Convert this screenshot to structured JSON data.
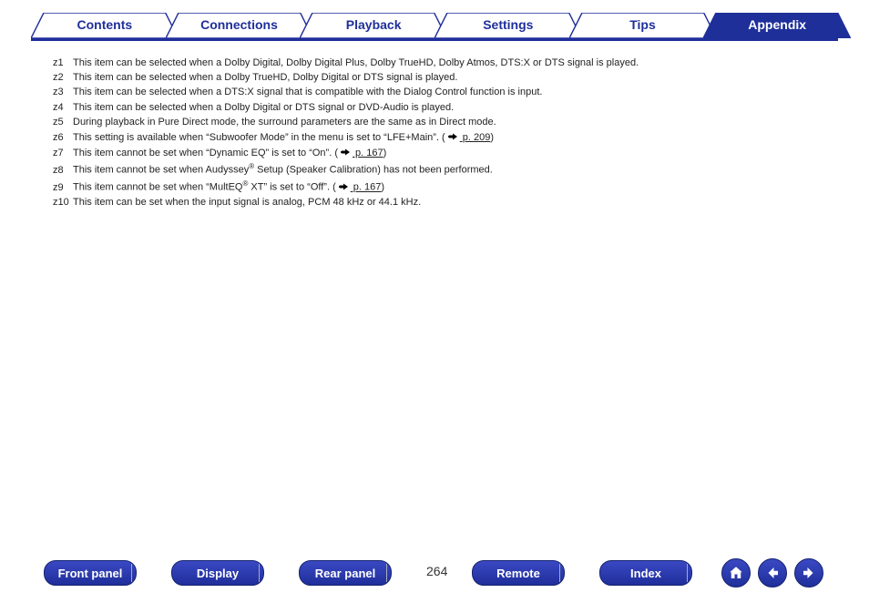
{
  "tabs": [
    {
      "label": "Contents"
    },
    {
      "label": "Connections"
    },
    {
      "label": "Playback"
    },
    {
      "label": "Settings"
    },
    {
      "label": "Tips"
    },
    {
      "label": "Appendix"
    }
  ],
  "active_tab_index": 5,
  "notes": [
    {
      "marker": "z1",
      "segments": [
        {
          "t": "This item can be selected when a Dolby Digital, Dolby Digital Plus, Dolby TrueHD, Dolby Atmos, DTS:X or DTS signal is played."
        }
      ]
    },
    {
      "marker": "z2",
      "segments": [
        {
          "t": "This item can be selected when a Dolby TrueHD, Dolby Digital or DTS signal is played."
        }
      ]
    },
    {
      "marker": "z3",
      "segments": [
        {
          "t": "This item can be selected when a DTS:X signal that is compatible with the Dialog Control function is input."
        }
      ]
    },
    {
      "marker": "z4",
      "segments": [
        {
          "t": "This item can be selected when a Dolby Digital or DTS signal or DVD-Audio is played."
        }
      ]
    },
    {
      "marker": "z5",
      "segments": [
        {
          "t": "During playback in Pure Direct mode, the surround parameters are the same as in Direct mode."
        }
      ]
    },
    {
      "marker": "z6",
      "segments": [
        {
          "t": "This setting is available when “Subwoofer Mode” in the menu is set to “LFE+Main”.  ("
        },
        {
          "hand": true
        },
        {
          "link": " p. 209"
        },
        {
          "t": ")"
        }
      ]
    },
    {
      "marker": "z7",
      "segments": [
        {
          "t": "This item cannot be set when “Dynamic EQ” is set to “On”.  ("
        },
        {
          "hand": true
        },
        {
          "link": " p. 167"
        },
        {
          "t": ")"
        }
      ]
    },
    {
      "marker": "z8",
      "segments": [
        {
          "t": "This item cannot be set when Audyssey"
        },
        {
          "sup": "®"
        },
        {
          "t": " Setup (Speaker Calibration) has not been performed."
        }
      ]
    },
    {
      "marker": "z9",
      "segments": [
        {
          "t": "This item cannot be set when “MultEQ"
        },
        {
          "sup": "®"
        },
        {
          "t": " XT” is set to “Off”.  ("
        },
        {
          "hand": true
        },
        {
          "link": " p. 167"
        },
        {
          "t": ")"
        }
      ]
    },
    {
      "marker": "z10",
      "segments": [
        {
          "t": "This item can be set when the input signal is analog, PCM 48 kHz or 44.1 kHz."
        }
      ]
    }
  ],
  "page_number": "264",
  "bottom_buttons": [
    {
      "label": "Front panel"
    },
    {
      "label": "Display"
    },
    {
      "label": "Rear panel"
    },
    {
      "label": "Remote"
    },
    {
      "label": "Index"
    }
  ],
  "colors": {
    "brand": "#1f2f9a"
  }
}
